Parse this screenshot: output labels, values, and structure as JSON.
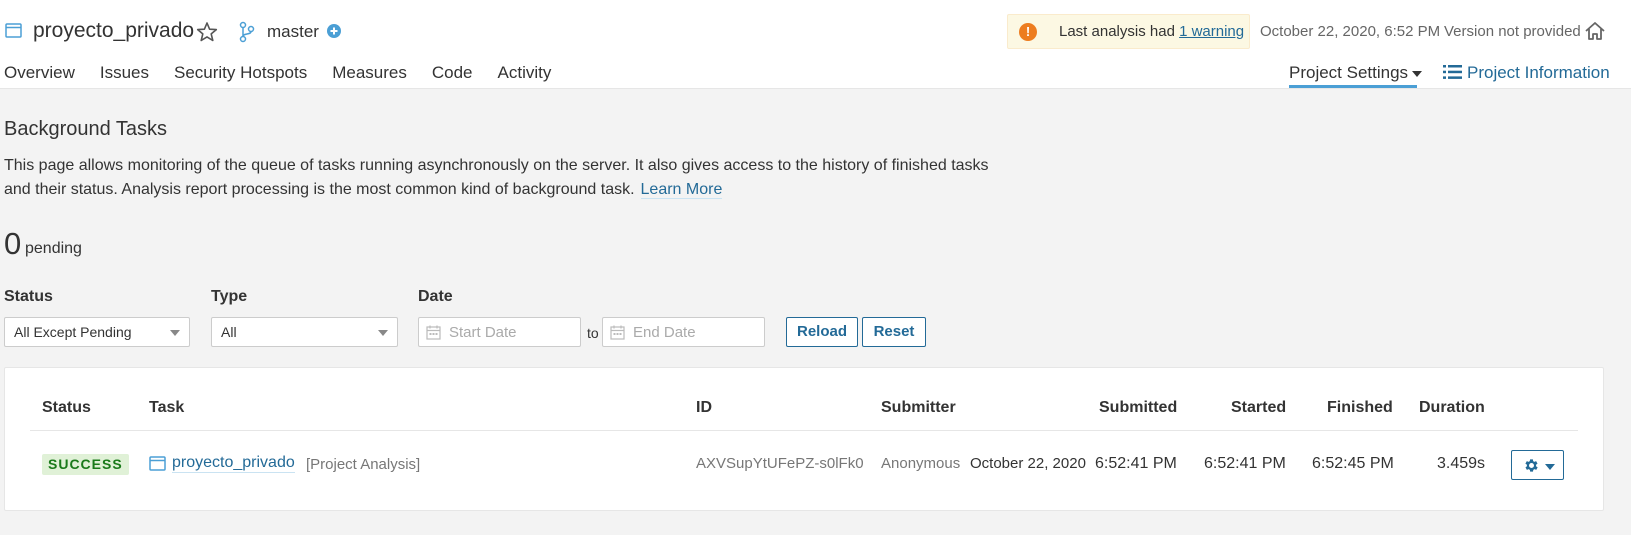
{
  "header": {
    "project_name": "proyecto_privado",
    "branch": "master",
    "warning": {
      "text_before": "Last analysis had ",
      "link": "1 warning"
    },
    "analysis_date": "October 22, 2020, 6:52 PM",
    "version": "Version not provided"
  },
  "nav": {
    "items": [
      "Overview",
      "Issues",
      "Security Hotspots",
      "Measures",
      "Code",
      "Activity"
    ],
    "project_settings": "Project Settings",
    "project_information": "Project Information"
  },
  "page": {
    "title": "Background Tasks",
    "description": "This page allows monitoring of the queue of tasks running asynchronously on the server. It also gives access to the history of finished tasks and their status. Analysis report processing is the most common kind of background task.",
    "learn_more": "Learn More",
    "pending_count": "0",
    "pending_label": "pending"
  },
  "filters": {
    "status_label": "Status",
    "status_value": "All Except Pending",
    "type_label": "Type",
    "type_value": "All",
    "date_label": "Date",
    "start_placeholder": "Start Date",
    "to_label": "to",
    "end_placeholder": "End Date",
    "reload": "Reload",
    "reset": "Reset"
  },
  "table": {
    "headers": [
      "Status",
      "Task",
      "ID",
      "Submitter",
      "Submitted",
      "Started",
      "Finished",
      "Duration"
    ],
    "rows": [
      {
        "status": "SUCCESS",
        "task": "proyecto_privado",
        "task_type": "[Project Analysis]",
        "id": "AXVSupYtUFePZ-s0lFk0",
        "submitter": "Anonymous",
        "submitted_date": "October 22, 2020",
        "submitted_time": "6:52:41 PM",
        "started": "6:52:41 PM",
        "finished": "6:52:45 PM",
        "duration": "3.459s"
      }
    ]
  },
  "colors": {
    "link": "#236a97",
    "success_bg": "#e0f1d7",
    "warning_bg": "#fcf8e3",
    "warning_icon": "#ed7d20",
    "active_tab_underline": "#4b9fd5"
  },
  "icons": [
    "project-icon",
    "star-icon",
    "branch-icon",
    "plus-circle-icon",
    "warning-icon",
    "home-icon",
    "list-icon",
    "calendar-icon",
    "gear-icon"
  ]
}
